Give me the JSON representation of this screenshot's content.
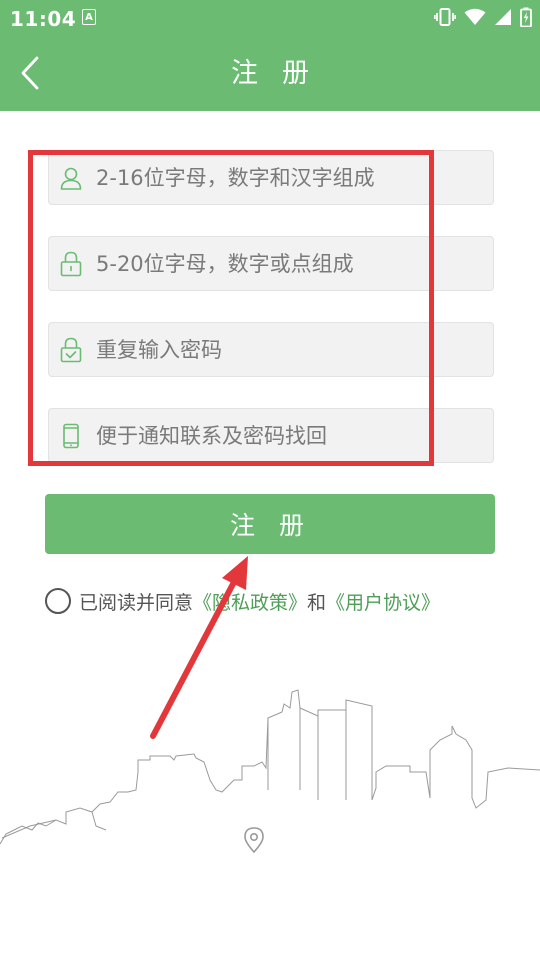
{
  "status_bar": {
    "time": "11:04",
    "app_icon_letter": "A"
  },
  "header": {
    "title": "注册",
    "background_color": "#6bbb73"
  },
  "form": {
    "username_placeholder": "2-16位字母，数字和汉字组成",
    "password_placeholder": "5-20位字母，数字或点组成",
    "confirm_password_placeholder": "重复输入密码",
    "phone_placeholder": "便于通知联系及密码找回"
  },
  "register_button": {
    "label": "注册"
  },
  "agreement": {
    "prefix": "已阅读并同意",
    "privacy_link": "《隐私政策》",
    "conjunction": "和",
    "user_agreement_link": "《用户协议》"
  },
  "annotation": {
    "box_color": "#e2383b",
    "arrow_color": "#e2383b"
  },
  "icons": {
    "back": "chevron-left-icon",
    "username": "user-icon",
    "password": "lock-icon",
    "confirm_password": "lock-check-icon",
    "phone": "phone-icon",
    "map_marker": "location-pin-icon"
  }
}
